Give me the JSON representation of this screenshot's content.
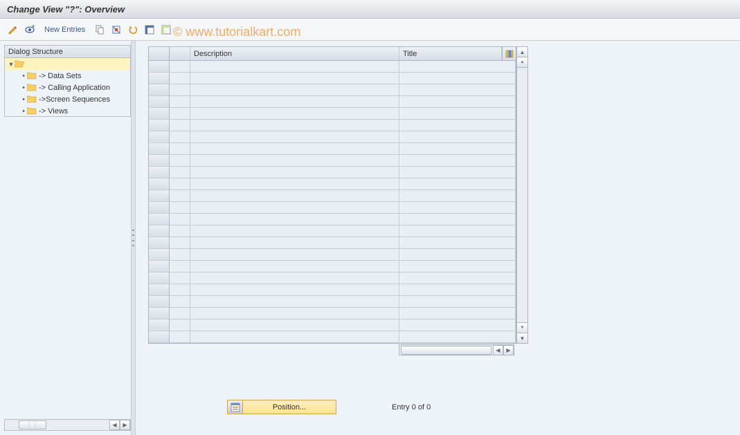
{
  "titlebar": {
    "text": "Change View \"?\": Overview"
  },
  "toolbar": {
    "new_entries": "New Entries"
  },
  "watermark": "© www.tutorialkart.com",
  "sidebar": {
    "header": "Dialog Structure",
    "items": [
      {
        "label": "-> Data Sets"
      },
      {
        "label": "-> Calling Application"
      },
      {
        "label": "->Screen Sequences"
      },
      {
        "label": "-> Views"
      }
    ]
  },
  "grid": {
    "columns": {
      "description": "Description",
      "title": "Title"
    }
  },
  "footer": {
    "position_label": "Position...",
    "entry_text": "Entry 0 of 0"
  }
}
